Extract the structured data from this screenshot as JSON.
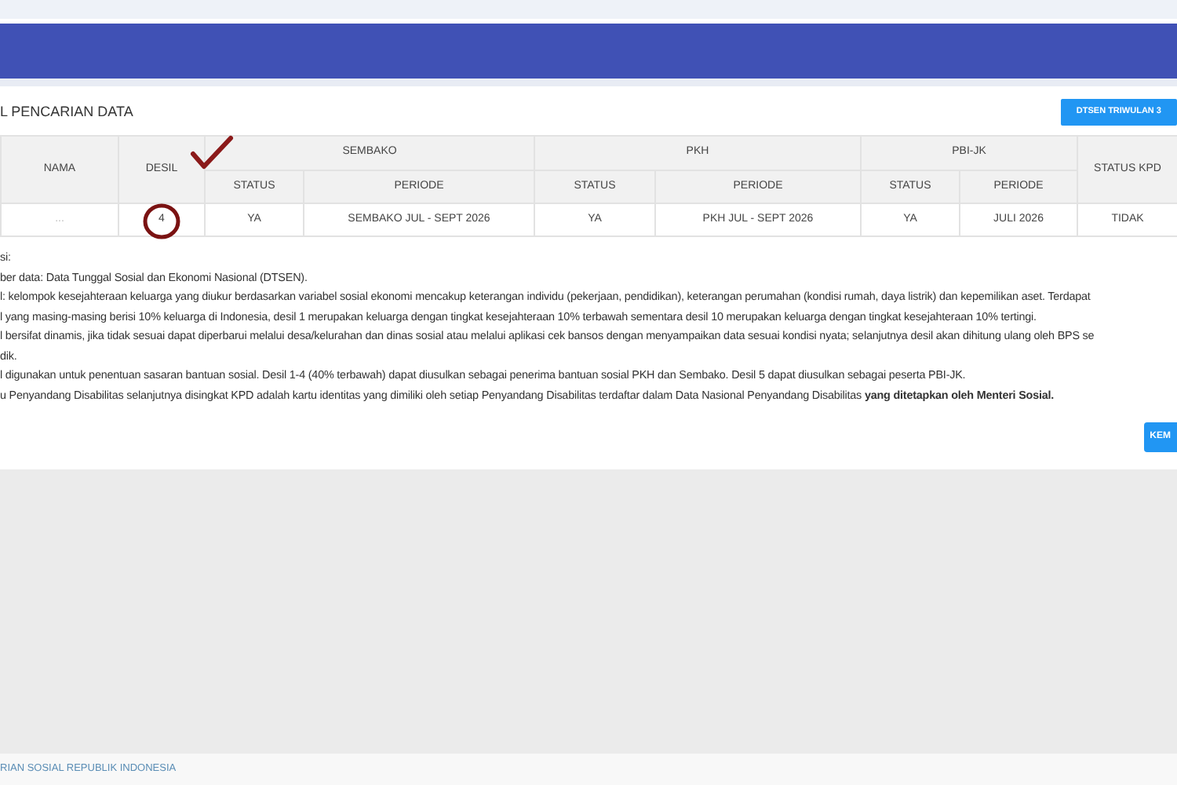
{
  "title": "L PENCARIAN DATA",
  "action_button": "DTSEN TRIWULAN 3",
  "table": {
    "columns": [
      {
        "label": "NAMA"
      },
      {
        "label": "DESIL"
      },
      {
        "label": "SEMBAKO",
        "colspan": 2,
        "children": [
          "STATUS",
          "PERIODE"
        ]
      },
      {
        "label": "PKH",
        "colspan": 2,
        "children": [
          "STATUS",
          "PERIODE"
        ]
      },
      {
        "label": "PBI-JK",
        "colspan": 2,
        "children": [
          "STATUS",
          "PERIODE"
        ]
      },
      {
        "label": "STATUS KPD"
      }
    ],
    "rows": [
      {
        "cells": [
          "...",
          "4",
          "YA",
          "SEMBAKO JUL - SEPT 2026",
          "YA",
          "PKH JUL - SEPT 2026",
          "YA",
          "JULI 2026",
          "TIDAK"
        ]
      }
    ]
  },
  "notes": [
    "si:",
    "ber data: Data Tunggal Sosial dan Ekonomi Nasional (DTSEN).",
    "l: kelompok kesejahteraan keluarga yang diukur berdasarkan variabel sosial ekonomi mencakup keterangan individu (pekerjaan, pendidikan), keterangan perumahan (kondisi rumah, daya listrik) dan kepemilikan aset. Terdapat",
    "l yang masing-masing berisi 10% keluarga di Indonesia, desil 1 merupakan keluarga dengan tingkat kesejahteraan 10% terbawah sementara desil 10 merupakan keluarga dengan tingkat kesejahteraan 10% tertingi.",
    "l bersifat dinamis, jika tidak sesuai dapat diperbarui melalui desa/kelurahan dan dinas sosial atau melalui aplikasi cek bansos dengan menyampaikan data sesuai kondisi nyata; selanjutnya desil akan dihitung ulang oleh BPS se",
    "dik.",
    "l digunakan untuk penentuan sasaran bantuan sosial. Desil 1-4 (40% terbawah) dapat diusulkan sebagai penerima bantuan sosial PKH dan Sembako. Desil 5 dapat diusulkan sebagai peserta PBI-JK.",
    "u Penyandang Disabilitas selanjutnya disingkat KPD adalah kartu identitas yang dimiliki oleh setiap Penyandang Disabilitas terdaftar dalam Data Nasional Penyandang Disabilitas **yang ditetapkan oleh Menteri Sosial.**"
  ],
  "back_button": "KEM",
  "footer": "RIAN SOSIAL REPUBLIK INDONESIA"
}
